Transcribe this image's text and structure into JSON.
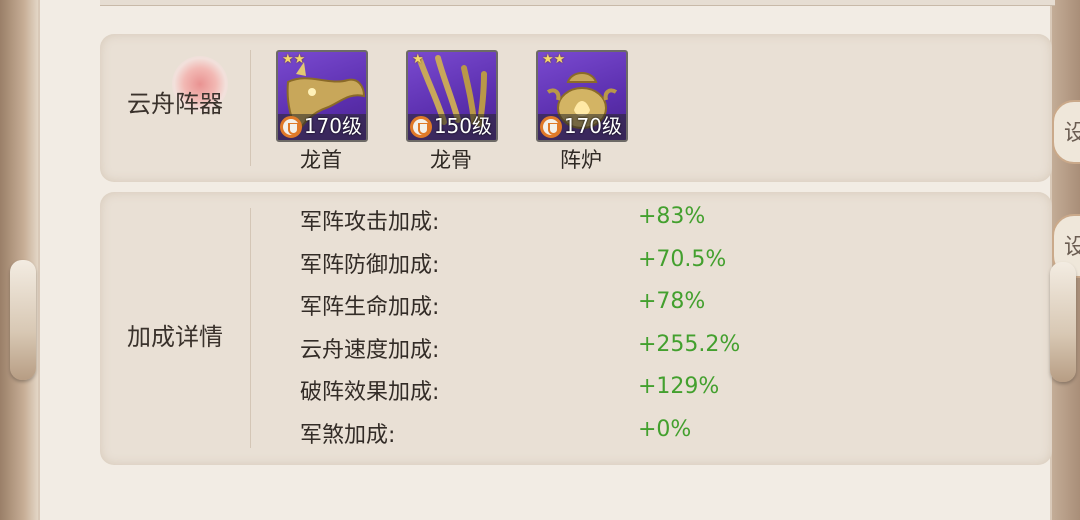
{
  "side_tabs": {
    "tab_top": "设",
    "tab_bottom": "设"
  },
  "artifacts_section": {
    "label_part1": "云舟",
    "label_part2": "阵器",
    "items": [
      {
        "name": "龙首",
        "level": "170级",
        "stars": "★★"
      },
      {
        "name": "龙骨",
        "level": "150级",
        "stars": "★"
      },
      {
        "name": "阵炉",
        "level": "170级",
        "stars": "★★"
      }
    ]
  },
  "bonus_section": {
    "label": "加成详情",
    "stats": [
      {
        "label": "军阵攻击加成:",
        "value": "+83%"
      },
      {
        "label": "军阵防御加成:",
        "value": "+70.5%"
      },
      {
        "label": "军阵生命加成:",
        "value": "+78%"
      },
      {
        "label": "云舟速度加成:",
        "value": "+255.2%"
      },
      {
        "label": "破阵效果加成:",
        "value": "+129%"
      },
      {
        "label": "军煞加成:",
        "value": "+0%"
      }
    ]
  },
  "colors": {
    "bonus_value": "#43a02e",
    "level_badge": "#e07a28",
    "artifact_bg": "#5b2fae"
  }
}
